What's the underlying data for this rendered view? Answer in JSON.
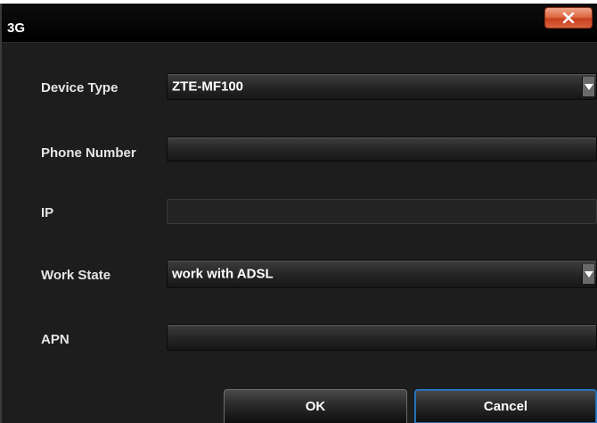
{
  "window": {
    "title": "3G",
    "close_icon": "close-x-icon"
  },
  "form": {
    "device_type": {
      "label": "Device Type",
      "value": "ZTE-MF100"
    },
    "phone_number": {
      "label": "Phone Number",
      "value": ""
    },
    "ip": {
      "label": "IP",
      "value": ""
    },
    "work_state": {
      "label": "Work State",
      "value": "work with ADSL"
    },
    "apn": {
      "label": "APN",
      "value": ""
    }
  },
  "buttons": {
    "ok_label": "OK",
    "cancel_label": "Cancel"
  },
  "colors": {
    "background": "#1d1d1d",
    "titlebar": "#000000",
    "close_button": "#d65a34",
    "focus_border": "#1f7fd6"
  }
}
